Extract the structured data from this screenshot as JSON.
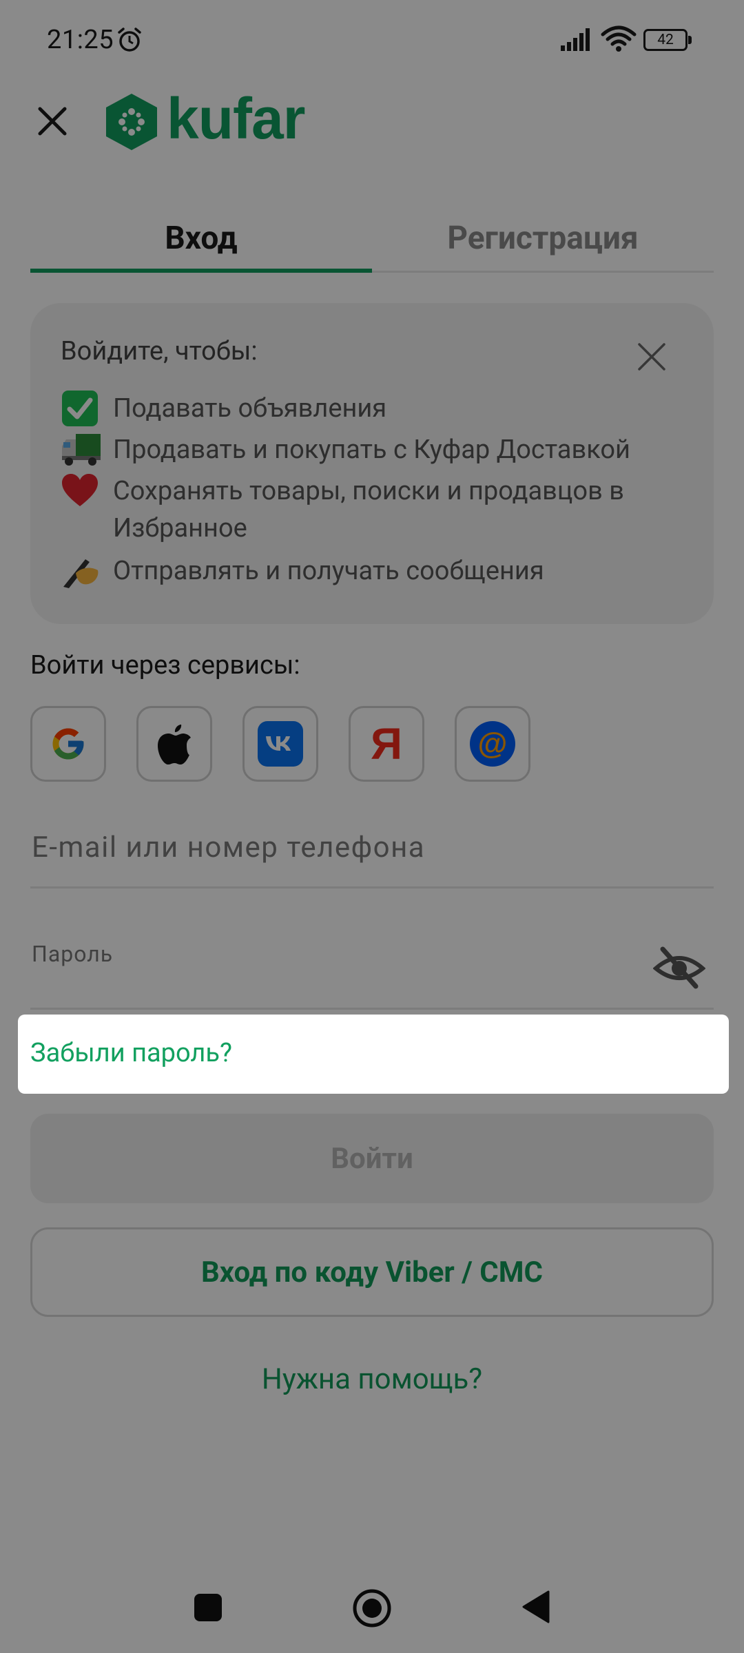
{
  "status_bar": {
    "time": "21:25",
    "battery": "42",
    "icons": [
      "alarm-icon",
      "signal-icon",
      "wifi-icon",
      "battery-icon"
    ]
  },
  "header": {
    "close_icon": "close-icon",
    "logo_text": "kufar",
    "brand_color": "#119d5e"
  },
  "tabs": [
    {
      "label": "Вход",
      "active": true
    },
    {
      "label": "Регистрация",
      "active": false
    }
  ],
  "info_card": {
    "title": "Войдите, чтобы:",
    "close_icon": "close-icon",
    "items": [
      {
        "icon": "check-mark-icon",
        "text": "Подавать объявления"
      },
      {
        "icon": "truck-icon",
        "text": "Продавать и покупать с Куфар Доставкой"
      },
      {
        "icon": "heart-icon",
        "text": "Сохранять товары, поиски и продавцов в Избранное"
      },
      {
        "icon": "writing-hand-icon",
        "text": "Отправлять и получать сообщения"
      }
    ]
  },
  "services": {
    "label": "Войти через сервисы:",
    "providers": [
      {
        "name": "google-icon"
      },
      {
        "name": "apple-icon"
      },
      {
        "name": "vk-icon"
      },
      {
        "name": "yandex-icon",
        "glyph": "Я"
      },
      {
        "name": "mailru-icon",
        "glyph": "@"
      }
    ]
  },
  "form": {
    "email_placeholder": "E-mail или номер телефона",
    "password_label": "Пароль",
    "password_toggle_icon": "eye-off-icon",
    "forgot_password": "Забыли пароль?",
    "login_button": "Войти",
    "code_login_button": "Вход по коду Viber / СМС",
    "help_link": "Нужна помощь?"
  },
  "nav_bar": {
    "icons": [
      "recents-square-icon",
      "home-circle-icon",
      "back-triangle-icon"
    ]
  },
  "colors": {
    "accent": "#119d5e",
    "overlay": "rgba(0,0,0,0.46)"
  }
}
